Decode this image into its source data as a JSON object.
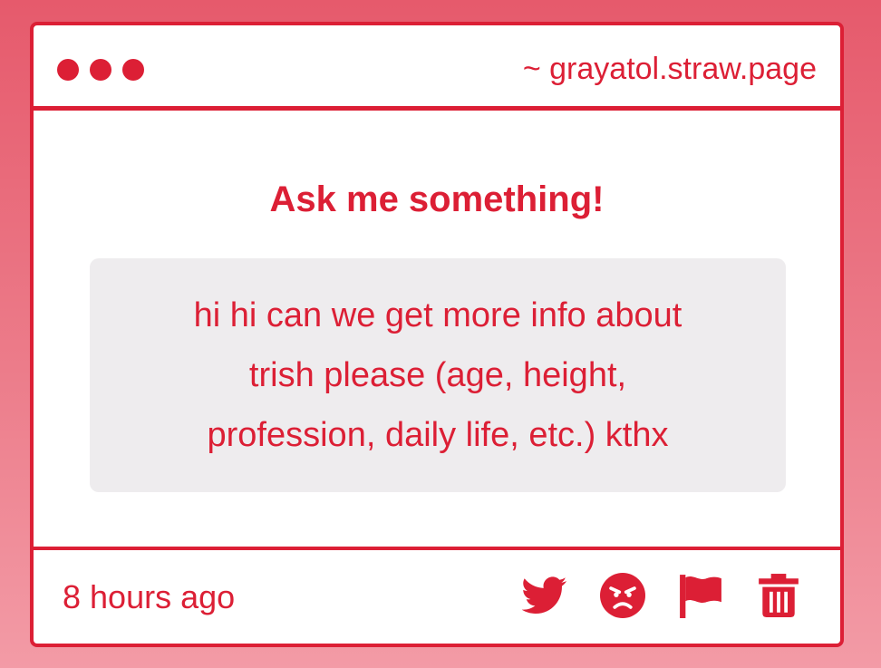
{
  "window": {
    "url": "~ grayatol.straw.page"
  },
  "main": {
    "heading": "Ask me something!",
    "question": "hi hi can we get more info about\ntrish please (age, height,\nprofession, daily life, etc.) kthx"
  },
  "footer": {
    "timestamp": "8 hours ago",
    "actions": [
      {
        "icon": "twitter-bird-icon"
      },
      {
        "icon": "angry-face-icon"
      },
      {
        "icon": "flag-icon"
      },
      {
        "icon": "trash-icon"
      }
    ]
  },
  "colors": {
    "accent": "#dc1f35",
    "card_background": "#ffffff",
    "question_background": "#eeecee",
    "page_gradient_top": "#e65a6c",
    "page_gradient_bottom": "#f39ba6"
  }
}
